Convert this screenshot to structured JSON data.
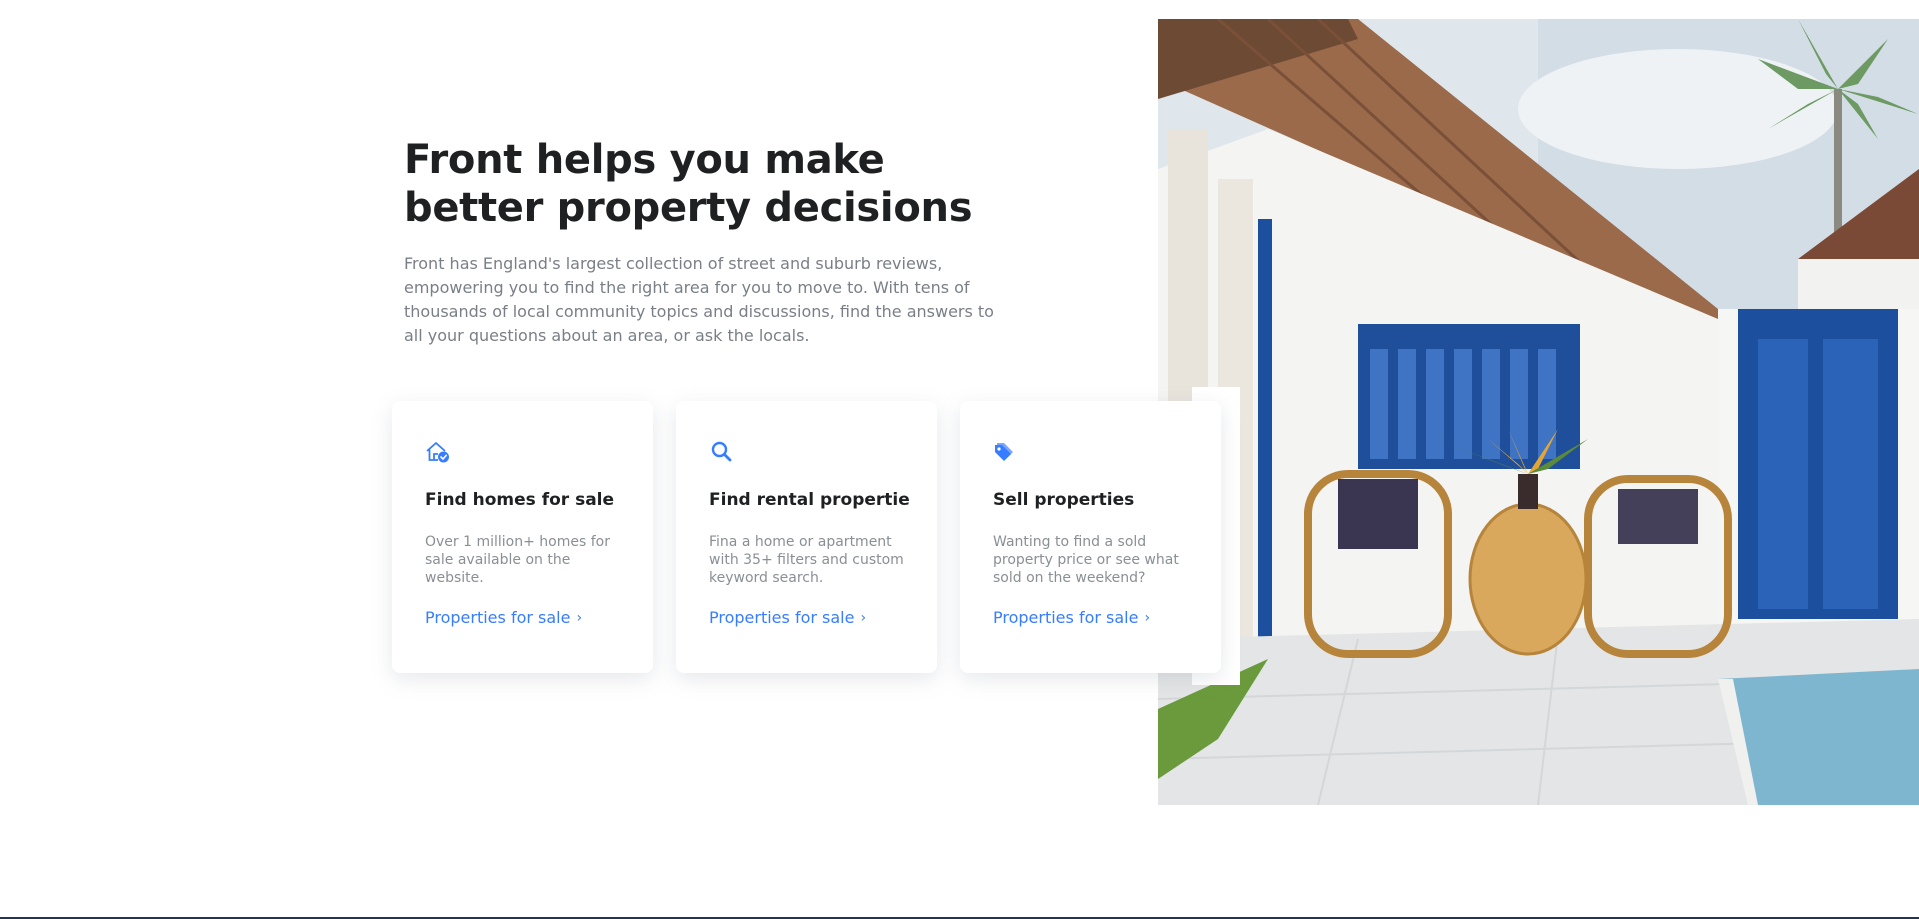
{
  "hero": {
    "title": "Front helps you make\nbetter property decisions",
    "description": "Front has England's largest collection of street and suburb reviews, empowering you to find the right area for you to move to. With tens of thousands of local community topics and discussions, find the answers to all your questions about an area, or ask the locals."
  },
  "cards": [
    {
      "icon": "house-check-icon",
      "title": "Find homes for sale",
      "text": "Over 1 million+ homes for sale available on the website.",
      "link_label": "Properties for sale"
    },
    {
      "icon": "search-icon",
      "title": "Find rental propertie",
      "text": "Fina a home or apartment with 35+ filters and custom keyword search.",
      "link_label": "Properties for sale"
    },
    {
      "icon": "tags-icon",
      "title": "Sell properties",
      "text": "Wanting to find a sold property price or see what sold on the weekend?",
      "link_label": "Properties for sale"
    }
  ],
  "colors": {
    "accent": "#377dff",
    "heading": "#1e2022",
    "body_text": "#7a7f87"
  }
}
